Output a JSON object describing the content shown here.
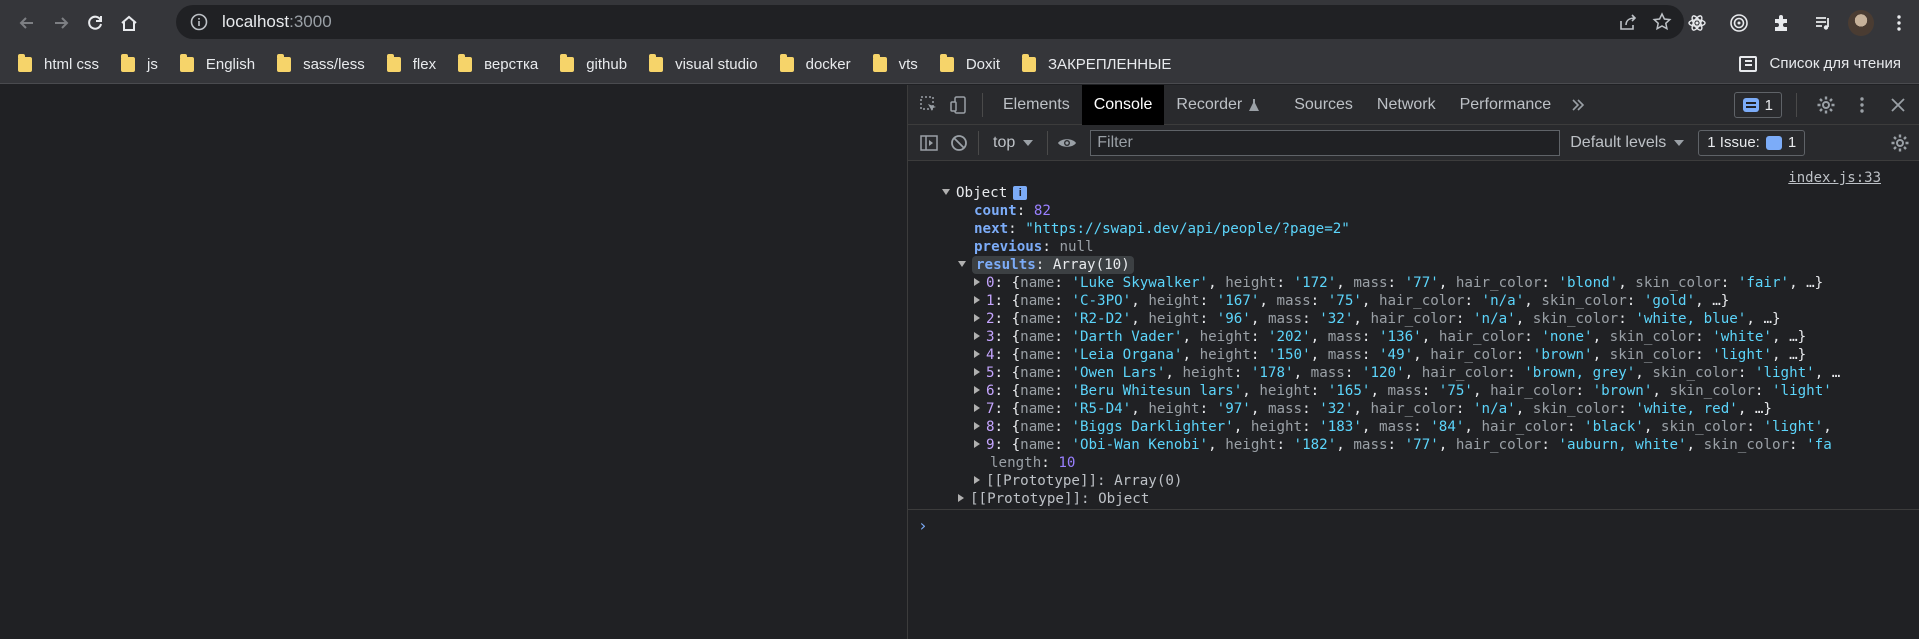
{
  "browser": {
    "url_host": "localhost",
    "url_port": ":3000"
  },
  "bookmarks": {
    "items": [
      "html css",
      "js",
      "English",
      "sass/less",
      "flex",
      "верстка",
      "github",
      "visual studio",
      "docker",
      "vts",
      "Doxit",
      "ЗАКРЕПЛЕННЫЕ"
    ],
    "reading_list": "Список для чтения"
  },
  "devtools": {
    "tabs": [
      "Elements",
      "Console",
      "Recorder",
      "Sources",
      "Network",
      "Performance"
    ],
    "active_tab": "Console",
    "messages_count": "1",
    "context": "top",
    "filter_placeholder": "Filter",
    "levels": "Default levels",
    "issues_label": "1 Issue:",
    "issues_count": "1"
  },
  "console": {
    "source": "index.js:33",
    "object_label": "Object",
    "count_key": "count",
    "count_val": "82",
    "next_key": "next",
    "next_val": "\"https://swapi.dev/api/people/?page=2\"",
    "previous_key": "previous",
    "previous_val": "null",
    "results_key": "results",
    "results_val": "Array(10)",
    "rows": [
      {
        "i": "0",
        "name": "'Luke Skywalker'",
        "height": "'172'",
        "mass": "'77'",
        "hair": "'blond'",
        "skin": "'fair'",
        "tail": ", …}"
      },
      {
        "i": "1",
        "name": "'C-3PO'",
        "height": "'167'",
        "mass": "'75'",
        "hair": "'n/a'",
        "skin": "'gold'",
        "tail": ", …}"
      },
      {
        "i": "2",
        "name": "'R2-D2'",
        "height": "'96'",
        "mass": "'32'",
        "hair": "'n/a'",
        "skin": "'white, blue'",
        "tail": ", …}"
      },
      {
        "i": "3",
        "name": "'Darth Vader'",
        "height": "'202'",
        "mass": "'136'",
        "hair": "'none'",
        "skin": "'white'",
        "tail": ", …}"
      },
      {
        "i": "4",
        "name": "'Leia Organa'",
        "height": "'150'",
        "mass": "'49'",
        "hair": "'brown'",
        "skin": "'light'",
        "tail": ", …}"
      },
      {
        "i": "5",
        "name": "'Owen Lars'",
        "height": "'178'",
        "mass": "'120'",
        "hair": "'brown, grey'",
        "skin": "'light'",
        "tail": ", …"
      },
      {
        "i": "6",
        "name": "'Beru Whitesun lars'",
        "height": "'165'",
        "mass": "'75'",
        "hair": "'brown'",
        "skin": "'light'",
        "tail": ""
      },
      {
        "i": "7",
        "name": "'R5-D4'",
        "height": "'97'",
        "mass": "'32'",
        "hair": "'n/a'",
        "skin": "'white, red'",
        "tail": ", …}"
      },
      {
        "i": "8",
        "name": "'Biggs Darklighter'",
        "height": "'183'",
        "mass": "'84'",
        "hair": "'black'",
        "skin": "'light'",
        "tail": ","
      },
      {
        "i": "9",
        "name": "'Obi-Wan Kenobi'",
        "height": "'182'",
        "mass": "'77'",
        "hair": "'auburn, white'",
        "skin": "'fa",
        "tail": ""
      }
    ],
    "length_key": "length",
    "length_val": "10",
    "proto_array": "[[Prototype]]: Array(0)",
    "proto_object": "[[Prototype]]: Object"
  }
}
